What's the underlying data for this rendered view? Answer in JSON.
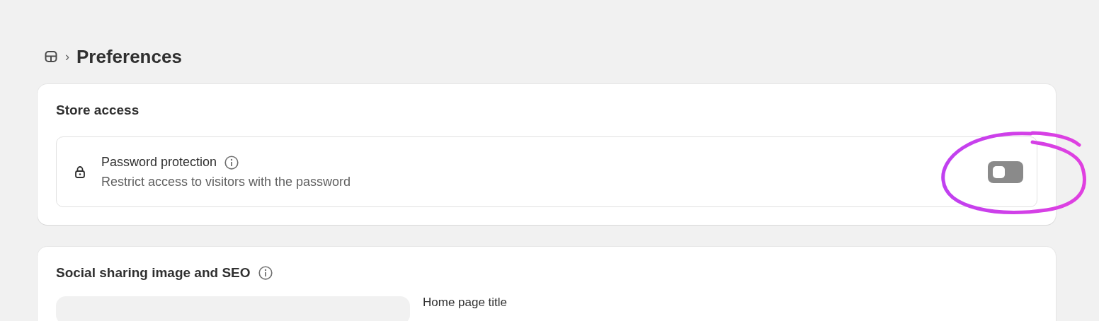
{
  "breadcrumb": {
    "separator": "›",
    "title": "Preferences"
  },
  "store_access": {
    "title": "Store access",
    "setting": {
      "label": "Password protection",
      "description": "Restrict access to visitors with the password",
      "on": false
    }
  },
  "social_sharing": {
    "title": "Social sharing image and SEO",
    "fields": [
      {
        "label": "Home page title"
      }
    ]
  }
}
